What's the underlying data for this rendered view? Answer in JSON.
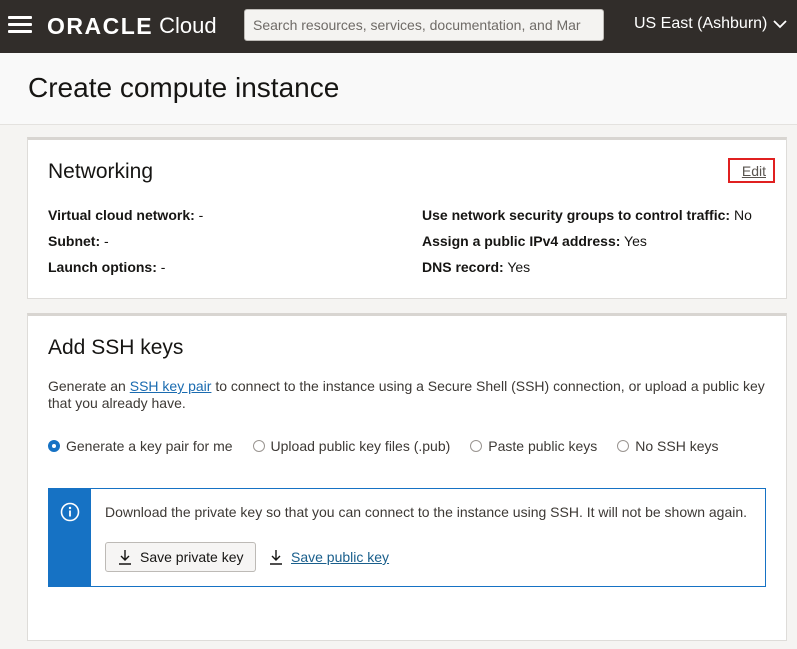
{
  "topbar": {
    "brand_oracle": "ORACLE",
    "brand_cloud": "Cloud",
    "search_placeholder": "Search resources, services, documentation, and Mar",
    "region": "US East (Ashburn)"
  },
  "page": {
    "title": "Create compute instance"
  },
  "networking": {
    "title": "Networking",
    "edit_label": "Edit",
    "left": [
      {
        "label": "Virtual cloud network:",
        "value": "-"
      },
      {
        "label": "Subnet:",
        "value": "-"
      },
      {
        "label": "Launch options:",
        "value": "-"
      }
    ],
    "right": [
      {
        "label": "Use network security groups to control traffic:",
        "value": "No"
      },
      {
        "label": "Assign a public IPv4 address:",
        "value": "Yes"
      },
      {
        "label": "DNS record:",
        "value": "Yes"
      }
    ]
  },
  "ssh": {
    "title": "Add SSH keys",
    "desc_pre": "Generate an ",
    "desc_link": "SSH key pair",
    "desc_post": " to connect to the instance using a Secure Shell (SSH) connection, or upload a public key that you already have.",
    "options": [
      {
        "label": "Generate a key pair for me",
        "checked": true
      },
      {
        "label": "Upload public key files (.pub)",
        "checked": false
      },
      {
        "label": "Paste public keys",
        "checked": false
      },
      {
        "label": "No SSH keys",
        "checked": false
      }
    ],
    "info_text": "Download the private key so that you can connect to the instance using SSH. It will not be shown again.",
    "save_private": "Save private key",
    "save_public": "Save public key"
  },
  "colors": {
    "topbar": "#312d2a",
    "accent": "#1672c4",
    "edit_highlight": "#e02020"
  },
  "icons": [
    "hamburger-icon",
    "chevron-down-icon",
    "info-icon",
    "download-icon"
  ]
}
